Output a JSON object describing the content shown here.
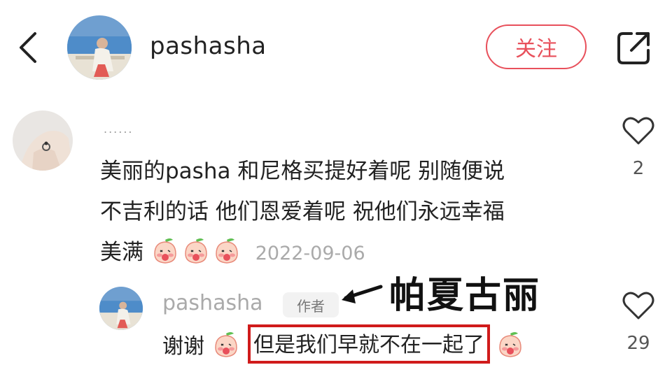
{
  "header": {
    "username": "pashasha",
    "follow_label": "关注"
  },
  "comment": {
    "username_dots": "......",
    "text_line1": "美丽的pasha 和尼格买提好着呢 别随便说",
    "text_line2": "不吉利的话 他们恩爱着呢  祝他们永远幸福",
    "text_line3": "美满",
    "emoji_count": 3,
    "date": "2022-09-06",
    "like_count": "2"
  },
  "reply": {
    "username": "pashasha",
    "author_tag": "作者",
    "annotation": "帕夏古丽",
    "text_start": "谢谢",
    "highlighted_text": "但是我们早就不在一起了",
    "like_count": "29"
  },
  "colors": {
    "accent_red": "#e8505b",
    "highlight_box": "#d01b1b"
  },
  "icons": [
    "back-icon",
    "share-icon",
    "heart-icon",
    "peach-emoji"
  ]
}
